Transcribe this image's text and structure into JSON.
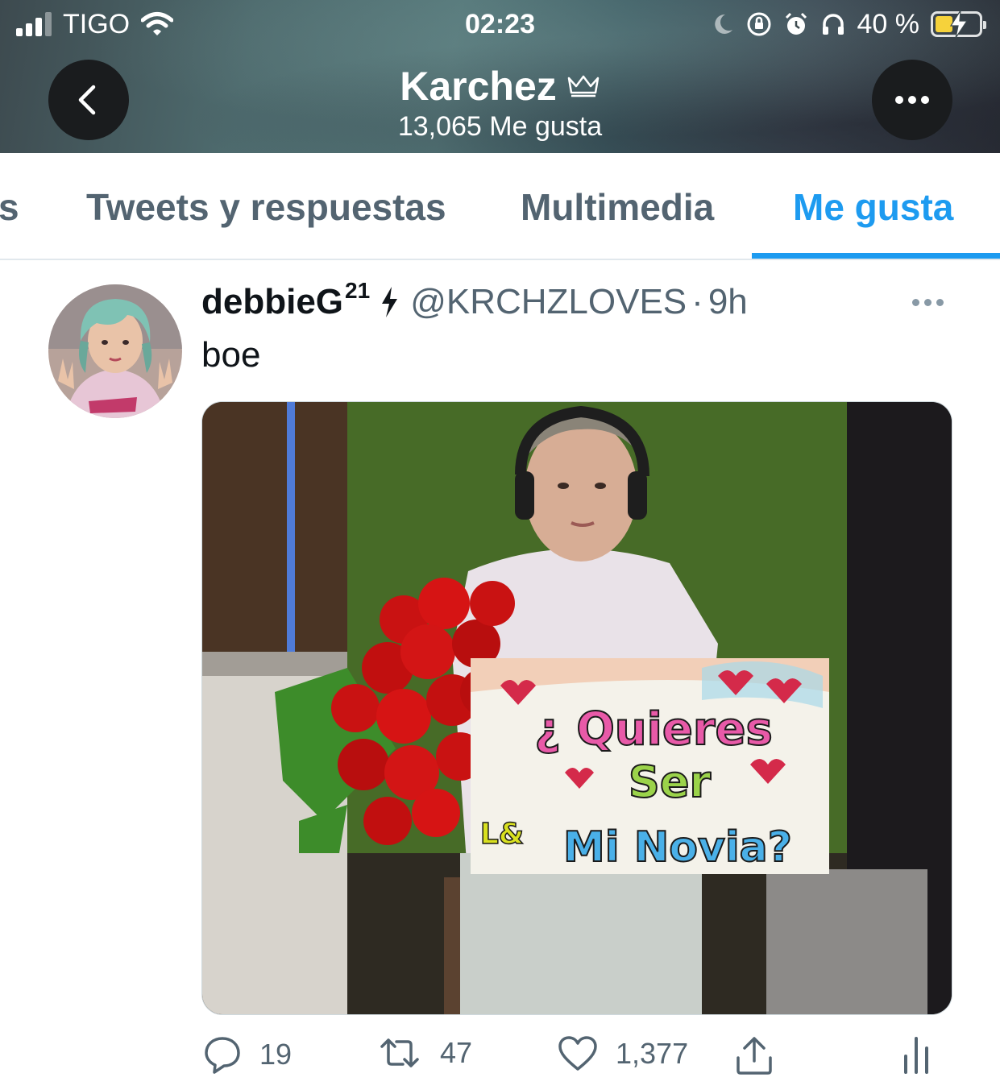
{
  "status_bar": {
    "carrier": "TIGO",
    "time": "02:23",
    "battery_percent": "40 %",
    "battery_level": 0.4,
    "colors": {
      "battery_fill": "#f6d23b"
    },
    "icons": [
      "signal-icon",
      "wifi-icon",
      "moon-icon",
      "rotation-lock-icon",
      "alarm-icon",
      "headphones-icon",
      "battery-icon"
    ]
  },
  "header": {
    "profile_name": "Karchez",
    "likes_count": "13,065 Me gusta",
    "icons": [
      "back-icon",
      "crown-icon",
      "more-icon"
    ]
  },
  "tabs": [
    {
      "label": "s",
      "active": false
    },
    {
      "label": "Tweets y respuestas",
      "active": false
    },
    {
      "label": "Multimedia",
      "active": false
    },
    {
      "label": "Me gusta",
      "active": true
    }
  ],
  "tweet": {
    "display_name": "debbieG",
    "display_name_sup": "21",
    "handle": "@KRCHZLOVES",
    "separator": "·",
    "time": "9h",
    "text": "boe",
    "media": {
      "sign_lines": [
        "¿ Quieres",
        "Ser",
        "Mi Novia?"
      ],
      "sign_corner": "L&"
    },
    "actions": {
      "replies": "19",
      "retweets": "47",
      "likes": "1,377"
    }
  },
  "colors": {
    "accent": "#1d9bf0",
    "secondary_text": "#536471",
    "primary_text": "#0f1419"
  }
}
